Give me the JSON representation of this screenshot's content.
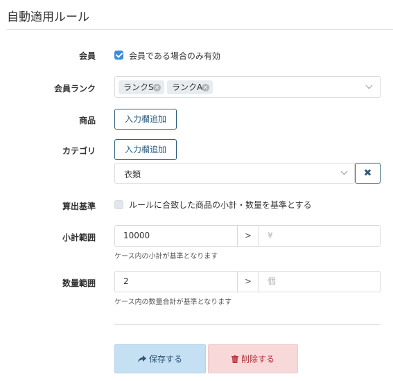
{
  "page": {
    "title": "自動適用ルール"
  },
  "member": {
    "label": "会員",
    "checkbox_label": "会員である場合のみ有効",
    "checked": true
  },
  "member_rank": {
    "label": "会員ランク",
    "selected": [
      "ランクS",
      "ランクA"
    ]
  },
  "product": {
    "label": "商品",
    "add_button": "入力欄追加"
  },
  "category": {
    "label": "カテゴリ",
    "add_button": "入力欄追加",
    "selected_value": "衣類",
    "remove_button": "✖"
  },
  "calc_basis": {
    "label": "算出基準",
    "checkbox_label": "ルールに合致した商品の小計・数量を基準とする",
    "checked": false
  },
  "subtotal_range": {
    "label": "小計範囲",
    "from_value": "10000",
    "separator": ">",
    "to_placeholder": "¥",
    "help": "ケース内の小計が基準となります"
  },
  "quantity_range": {
    "label": "数量範囲",
    "from_value": "2",
    "separator": ">",
    "to_placeholder": "個",
    "help": "ケース内の数量合計が基準となります"
  },
  "actions": {
    "save_label": "保存する",
    "delete_label": "削除する",
    "save_icon": "share-arrow-icon",
    "delete_icon": "trash-icon"
  },
  "colors": {
    "accent": "#3b8bd8",
    "outline_button": "#2c5c7e",
    "save_bg": "#c5dff3",
    "delete_bg": "#f8d9d9",
    "delete_text": "#b3313a"
  }
}
